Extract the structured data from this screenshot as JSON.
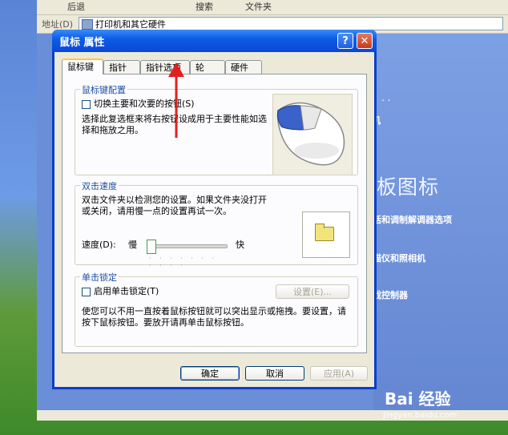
{
  "background": {
    "toolbar": [
      "后退",
      "搜索",
      "文件夹"
    ],
    "address_label": "地址(D)",
    "address_value": "打印机和其它硬件",
    "panel_title": "制面板图标",
    "side_items": [
      "电话和调制解调器选项",
      "扫描仪和照相机",
      "游戏控制器"
    ],
    "dots": ". .",
    "partial_item": "机"
  },
  "dialog": {
    "title": "鼠标 属性",
    "help_glyph": "?",
    "close_glyph": "✕",
    "tabs": [
      "鼠标键",
      "指针",
      "指针选项",
      "轮",
      "硬件"
    ],
    "mouse_button_group": {
      "title": "鼠标键配置",
      "checkbox_label": "切换主要和次要的按钮(S)",
      "description": "选择此复选框来将右按钮设成用于主要性能如选择和拖放之用。"
    },
    "double_click_group": {
      "title": "双击速度",
      "description": "双击文件夹以检测您的设置。如果文件夹没打开或关闭，请用慢一点的设置再试一次。",
      "speed_label": "速度(D):",
      "slow": "慢",
      "fast": "快",
      "speed_level_fraction": 0.02
    },
    "click_lock_group": {
      "title": "单击锁定",
      "checkbox_label": "启用单击锁定(T)",
      "settings_button": "设置(E)...",
      "description": "使您可以不用一直按着鼠标按钮就可以突出显示或拖拽。要设置，请按下鼠标按钮。要放开请再单击鼠标按钮。"
    },
    "buttons": {
      "ok": "确定",
      "cancel": "取消",
      "apply": "应用(A)"
    }
  },
  "watermark": {
    "brand": "Bai 经验",
    "url": "jingyan.baidu.com"
  },
  "colors": {
    "title_blue": "#0a48d6",
    "group_title": "#1f4ea0",
    "annotation_arrow": "#e02020"
  }
}
